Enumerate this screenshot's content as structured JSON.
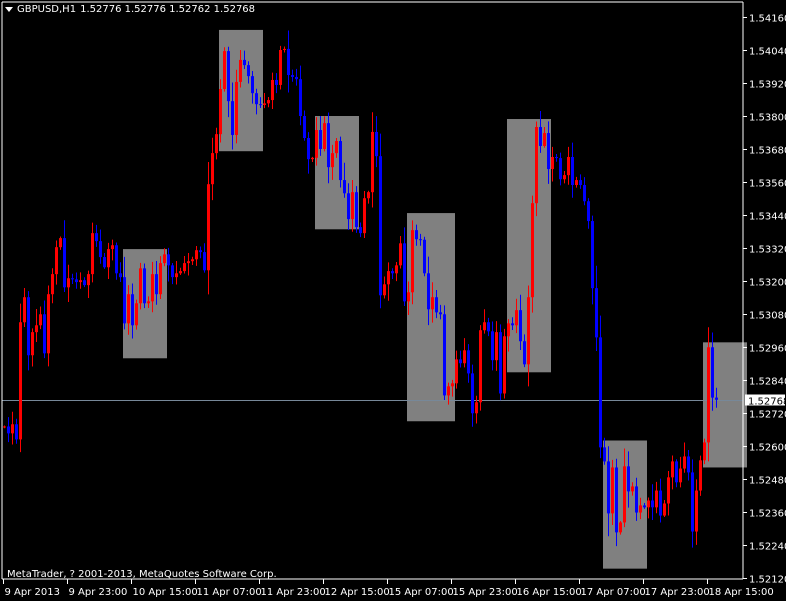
{
  "header": {
    "symbol": "GBPUSD,H1",
    "ohlc": "1.52776 1.52776 1.52762 1.52768"
  },
  "copyright": "MetaTrader, ? 2001-2013, MetaQuotes Software Corp.",
  "colors": {
    "bull": "#FF0000",
    "bear": "#0000FF",
    "background": "#000000",
    "rect": "#808080",
    "price_line": "#778899",
    "axis": "#FFFFFF"
  },
  "chart_data": {
    "type": "candlestick",
    "title": "GBPUSD,H1",
    "timeframe": "H1",
    "first_open": 1.52668,
    "closes": [
      1.52671,
      1.52646,
      1.52679,
      1.52624,
      1.5305,
      1.53141,
      1.5293,
      1.53014,
      1.53039,
      1.53079,
      1.52937,
      1.53152,
      1.53225,
      1.53323,
      1.53356,
      1.53177,
      1.5321,
      1.53206,
      1.53196,
      1.53203,
      1.53185,
      1.53225,
      1.53374,
      1.53345,
      1.53287,
      1.5325,
      1.53316,
      1.5333,
      1.53228,
      1.53214,
      1.53046,
      1.53152,
      1.53039,
      1.53119,
      1.53246,
      1.53119,
      1.53126,
      1.53225,
      1.53152,
      1.53265,
      1.53297,
      1.53257,
      1.53214,
      1.53228,
      1.53236,
      1.53265,
      1.53272,
      1.53279,
      1.53312,
      1.53305,
      1.53239,
      1.53552,
      1.53665,
      1.53734,
      1.53898,
      1.54036,
      1.53854,
      1.53731,
      1.53924,
      1.54004,
      1.53985,
      1.53945,
      1.53883,
      1.53843,
      1.5384,
      1.53846,
      1.53858,
      1.53931,
      1.53913,
      1.5404,
      1.54044,
      1.53949,
      1.53942,
      1.53934,
      1.538,
      1.5372,
      1.53643,
      1.53648,
      1.53749,
      1.5368,
      1.53774,
      1.53614,
      1.53665,
      1.53709,
      1.53567,
      1.53519,
      1.53425,
      1.53523,
      1.53396,
      1.53374,
      1.53501,
      1.53523,
      1.53742,
      1.53654,
      1.53148,
      1.53188,
      1.53236,
      1.53228,
      1.53257,
      1.53337,
      1.53126,
      1.53159,
      1.53385,
      1.53352,
      1.5335,
      1.53228,
      1.53097,
      1.53141,
      1.53086,
      1.53079,
      1.52784,
      1.52817,
      1.52828,
      1.52915,
      1.52901,
      1.52948,
      1.52864,
      1.52719,
      1.52759,
      1.53021,
      1.5305,
      1.53017,
      1.52912,
      1.53014,
      1.52791,
      1.52999,
      1.53046,
      1.53039,
      1.53094,
      1.52981,
      1.52897,
      1.53141,
      1.53483,
      1.5376,
      1.53691,
      1.53738,
      1.53607,
      1.53651,
      1.53647,
      1.5357,
      1.53585,
      1.53651,
      1.53549,
      1.53567,
      1.53549,
      1.5349,
      1.53418,
      1.53174,
      1.52995,
      1.52595,
      1.52544,
      1.52355,
      1.52522,
      1.52286,
      1.52322,
      1.52526,
      1.52435,
      1.52453,
      1.52358,
      1.52384,
      1.52377,
      1.52402,
      1.52377,
      1.52438,
      1.52347,
      1.52391,
      1.52486,
      1.52544,
      1.52468,
      1.52518,
      1.52562,
      1.52504,
      1.52289,
      1.52438,
      1.52548,
      1.52613,
      1.52959,
      1.52776,
      1.52768
    ],
    "current_price": "1.52768",
    "y_ticks": [
      "1.54160",
      "1.54040",
      "1.53920",
      "1.53800",
      "1.53680",
      "1.53560",
      "1.53440",
      "1.53320",
      "1.53200",
      "1.53080",
      "1.52960",
      "1.52840",
      "1.52720",
      "1.52600",
      "1.52480",
      "1.52360",
      "1.52240",
      "1.52120"
    ],
    "ylim": [
      1.5212,
      1.5416
    ],
    "x_ticks": [
      "9 Apr 2013",
      "9 Apr 23:00",
      "10 Apr 15:00",
      "11 Apr 07:00",
      "11 Apr 23:00",
      "12 Apr 15:00",
      "15 Apr 07:00",
      "15 Apr 23:00",
      "16 Apr 15:00",
      "17 Apr 07:00",
      "17 Apr 23:00",
      "18 Apr 15:00"
    ],
    "x_tick_every_bars": 16,
    "rectangles": [
      {
        "from_bar": 31,
        "to_bar": 41,
        "top": 1.53316,
        "bottom": 1.52919
      },
      {
        "from_bar": 55,
        "to_bar": 65,
        "top": 1.54113,
        "bottom": 1.53672
      },
      {
        "from_bar": 79,
        "to_bar": 89,
        "top": 1.538,
        "bottom": 1.53388
      },
      {
        "from_bar": 102,
        "to_bar": 113,
        "top": 1.53447,
        "bottom": 1.5269
      },
      {
        "from_bar": 127,
        "to_bar": 137,
        "top": 1.53789,
        "bottom": 1.52868
      },
      {
        "from_bar": 151,
        "to_bar": 161,
        "top": 1.5262,
        "bottom": 1.52154
      },
      {
        "from_bar": 176,
        "to_bar": 186,
        "top": 1.52977,
        "bottom": 1.52522
      }
    ]
  }
}
